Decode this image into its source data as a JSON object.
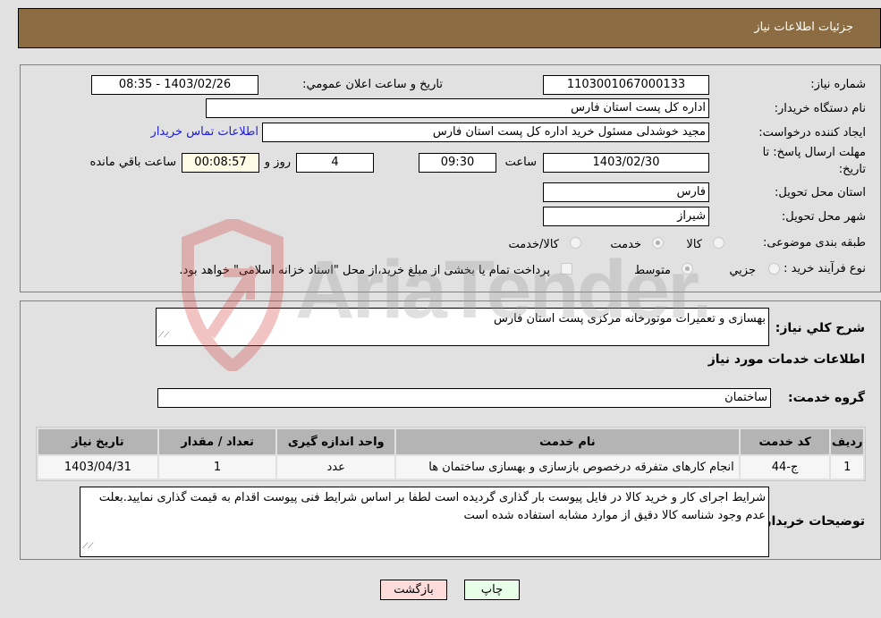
{
  "header": {
    "title": "جزئیات اطلاعات نیاز"
  },
  "info": {
    "need_number_label": "شماره نیاز:",
    "need_number": "1103001067000133",
    "announce_label": "تاریخ و ساعت اعلان عمومي:",
    "announce_value": "1403/02/26 - 08:35",
    "buyer_org_label": "نام دستگاه خریدار:",
    "buyer_org": "اداره کل پست استان فارس",
    "creator_label": "ایجاد کننده درخواست:",
    "creator": "مجید خوشدلی مسئول خرید اداره کل پست استان فارس",
    "contact_link": "اطلاعات تماس خریدار",
    "deadline_label_line1": "مهلت ارسال پاسخ: تا",
    "deadline_label_line2": "تاریخ:",
    "deadline_date": "1403/02/30",
    "time_label": "ساعت",
    "deadline_time": "09:30",
    "days_value": "4",
    "days_label": "روز و",
    "remaining_time": "00:08:57",
    "remaining_label": "ساعت باقي مانده",
    "province_label": "استان محل تحویل:",
    "province": "فارس",
    "city_label": "شهر محل تحویل:",
    "city": "شیراز",
    "category_label": "طبقه بندی موضوعی:",
    "category_options": [
      {
        "label": "کالا",
        "checked": false
      },
      {
        "label": "خدمت",
        "checked": true
      },
      {
        "label": "کالا/خدمت",
        "checked": false
      }
    ],
    "process_label": "نوع فرآیند خرید :",
    "process_options": [
      {
        "label": "جزيي",
        "checked": false
      },
      {
        "label": "متوسط",
        "checked": true
      }
    ],
    "treasury_note": "پرداخت تمام یا بخشی از مبلغ خرید،از محل \"اسناد خزانه اسلامی\" خواهد بود."
  },
  "details": {
    "description_label": "شرح کلي نیاز:",
    "description": "بهسازی و تعمیرات موتورخانه مرکزی پست استان فارس",
    "services_heading": "اطلاعات خدمات مورد نیاز",
    "service_group_label": "گروه خدمت:",
    "service_group": "ساختمان",
    "table": {
      "headers": [
        "ردیف",
        "کد خدمت",
        "نام خدمت",
        "واحد اندازه گیری",
        "تعداد / مقدار",
        "تاریخ نیاز"
      ],
      "rows": [
        [
          "1",
          "ج-44",
          "انجام کارهای متفرقه درخصوص بازسازی و بهسازی ساختمان ها",
          "عدد",
          "1",
          "1403/04/31"
        ]
      ]
    },
    "buyer_notes_label": "توضیحات خریدار:",
    "buyer_notes": "شرایط اجرای کار و خرید کالا در فایل پیوست بار گذاری گردیده است لطفا بر اساس شرایط فنی پیوست اقدام به قیمت گذاری نمایید.بعلت عدم وجود شناسه کالا دقیق از موارد مشابه استفاده شده است"
  },
  "buttons": {
    "print": "چاپ",
    "back": "بازگشت"
  },
  "watermark": {
    "text": "AriaTender.neT"
  }
}
